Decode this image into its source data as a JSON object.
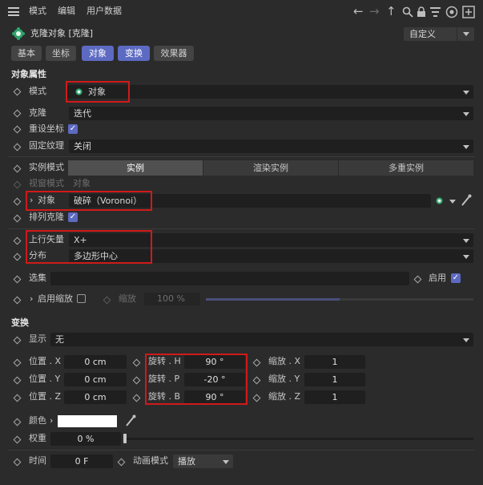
{
  "menubar": {
    "items": [
      "模式",
      "编辑",
      "用户数据"
    ]
  },
  "object": {
    "title": "克隆对象 [克隆]",
    "preset": "自定义"
  },
  "tabs": [
    {
      "label": "基本",
      "active": false
    },
    {
      "label": "坐标",
      "active": false
    },
    {
      "label": "对象",
      "active": true
    },
    {
      "label": "变换",
      "active": true
    },
    {
      "label": "效果器",
      "active": false
    }
  ],
  "object_props": {
    "section": "对象属性",
    "mode_label": "模式",
    "mode_value": "对象",
    "clone_label": "克隆",
    "clone_value": "迭代",
    "reset_label": "重设坐标",
    "reset_checked": true,
    "texture_label": "固定纹理",
    "texture_value": "关闭",
    "instance_label": "实例模式",
    "instance_options": [
      "实例",
      "渲染实例",
      "多重实例"
    ],
    "viewport_label": "视窗模式",
    "viewport_value": "对象",
    "obj_label": "对象",
    "obj_value": "破碎（Voronoi）",
    "arrange_label": "排列克隆",
    "arrange_checked": true,
    "up_label": "上行矢量",
    "up_value": "X+",
    "dist_label": "分布",
    "dist_value": "多边形中心",
    "sel_label": "选集",
    "enable_label": "启用",
    "enable_checked": true,
    "scale_enable_label": "启用缩放",
    "scale_enable_checked": false,
    "scale_label": "缩放",
    "scale_value": "100 %"
  },
  "transform": {
    "section": "变换",
    "display_label": "显示",
    "display_value": "无",
    "pos": [
      {
        "label": "位置 . X",
        "value": "0 cm"
      },
      {
        "label": "位置 . Y",
        "value": "0 cm"
      },
      {
        "label": "位置 . Z",
        "value": "0 cm"
      }
    ],
    "rot": [
      {
        "label": "旋转 . H",
        "value": "90 °"
      },
      {
        "label": "旋转 . P",
        "value": "-20 °"
      },
      {
        "label": "旋转 . B",
        "value": "90 °"
      }
    ],
    "scl": [
      {
        "label": "缩放 . X",
        "value": "1"
      },
      {
        "label": "缩放 . Y",
        "value": "1"
      },
      {
        "label": "缩放 . Z",
        "value": "1"
      }
    ],
    "color_label": "颜色",
    "weight_label": "权重",
    "weight_value": "0 %",
    "time_label": "时间",
    "time_value": "0 F",
    "anim_label": "动画模式",
    "anim_value": "播放"
  },
  "colors": {
    "accent": "#5d6ac2",
    "highlight_box": "#d01a1a",
    "background": "#2b2b2b",
    "field": "#1f1f1f"
  }
}
